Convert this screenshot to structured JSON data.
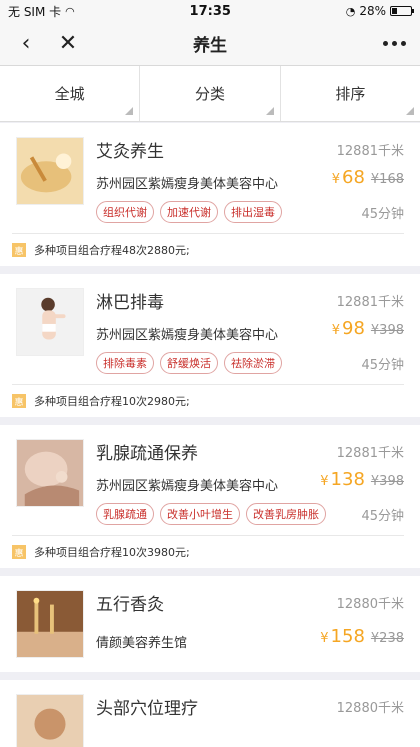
{
  "status": {
    "carrier": "无 SIM 卡",
    "time": "17:35",
    "battery": "28%",
    "battery_level": 0.28
  },
  "nav": {
    "back_icon": "chevron-left-icon",
    "close_icon": "close-icon",
    "title": "养生",
    "more_icon": "more-icon"
  },
  "filters": [
    {
      "label": "全城"
    },
    {
      "label": "分类"
    },
    {
      "label": "排序"
    }
  ],
  "cards": [
    {
      "title": "艾灸养生",
      "distance": "12881千米",
      "shop": "苏州园区紫嫣瘦身美体美容中心",
      "currency": "¥",
      "price": "68",
      "old_price": "¥168",
      "tags": [
        "组织代谢",
        "加速代谢",
        "排出湿毒"
      ],
      "duration": "45分钟",
      "promo_badge": "惠",
      "promo": "多种项目组合疗程48次2880元;",
      "image": "moxibustion",
      "accent": "#e9c98a"
    },
    {
      "title": "淋巴排毒",
      "distance": "12881千米",
      "shop": "苏州园区紫嫣瘦身美体美容中心",
      "currency": "¥",
      "price": "98",
      "old_price": "¥398",
      "tags": [
        "排除毒素",
        "舒缓焕活",
        "祛除淤滞"
      ],
      "duration": "45分钟",
      "promo_badge": "惠",
      "promo": "多种项目组合疗程10次2980元;",
      "image": "model",
      "accent": "#d9d9d9"
    },
    {
      "title": "乳腺疏通保养",
      "distance": "12881千米",
      "shop": "苏州园区紫嫣瘦身美体美容中心",
      "currency": "¥",
      "price": "138",
      "old_price": "¥398",
      "tags": [
        "乳腺疏通",
        "改善小叶增生",
        "改善乳房肿胀"
      ],
      "duration": "45分钟",
      "promo_badge": "惠",
      "promo": "多种项目组合疗程10次3980元;",
      "image": "massage",
      "accent": "#c9a08a"
    },
    {
      "title": "五行香灸",
      "distance": "12880千米",
      "shop": "倩颜美容养生馆",
      "currency": "¥",
      "price": "158",
      "old_price": "¥238",
      "image": "incense",
      "accent": "#b77a4a"
    },
    {
      "title": "头部穴位理疗",
      "distance": "12880千米",
      "image": "head",
      "accent": "#d8b48c"
    }
  ]
}
